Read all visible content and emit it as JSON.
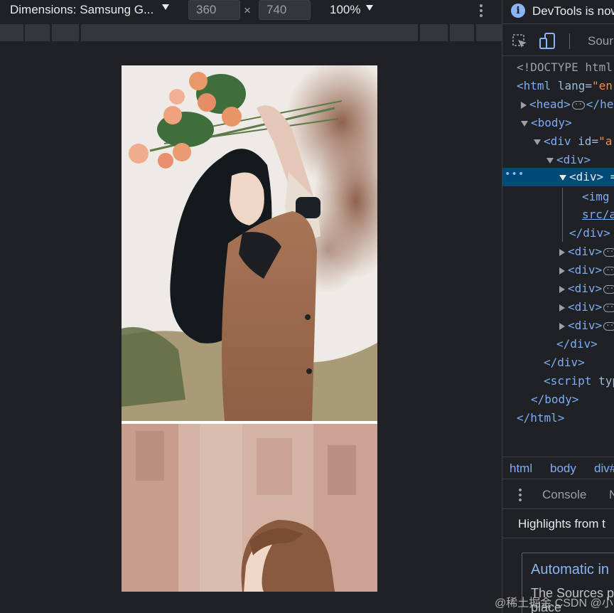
{
  "device_toolbar": {
    "dimensions_label": "Dimensions: Samsung G...",
    "width": "360",
    "height": "740",
    "times": "×",
    "zoom": "100%"
  },
  "devtools": {
    "info_text": "DevTools is now",
    "sources_tab": "Sour",
    "dom": {
      "doctype": "<!DOCTYPE html",
      "html_open": "<html",
      "html_attr": "lang=",
      "html_val": "\"en",
      "head": "<head>",
      "head_close": "</he",
      "body": "<body>",
      "div_id": "<div",
      "div_id_attr": "id=",
      "div_id_val": "\"a",
      "div_inner": "<div>",
      "div_selected": "<div> =",
      "img": "<img",
      "img_src": "src/a",
      "div_close": "</div>",
      "div_collapsed": "<div>",
      "div_close_2": "</div>",
      "div_close_3": "</div>",
      "script": "<script",
      "script_attr": "typ",
      "body_close": "</body>",
      "html_close": "</html>"
    },
    "breadcrumbs": [
      "html",
      "body",
      "div#"
    ],
    "console_tab": "Console",
    "n_tab": "N",
    "highlights": "Highlights from t",
    "card_title": "Automatic in",
    "card_body_1": "The Sources p",
    "card_body_2": "place"
  },
  "watermark": "@稀土掘金 CSDN @小满zs",
  "colors": {
    "accent": "#8ab4f8",
    "selected_row": "#004a77",
    "background": "#202124"
  }
}
